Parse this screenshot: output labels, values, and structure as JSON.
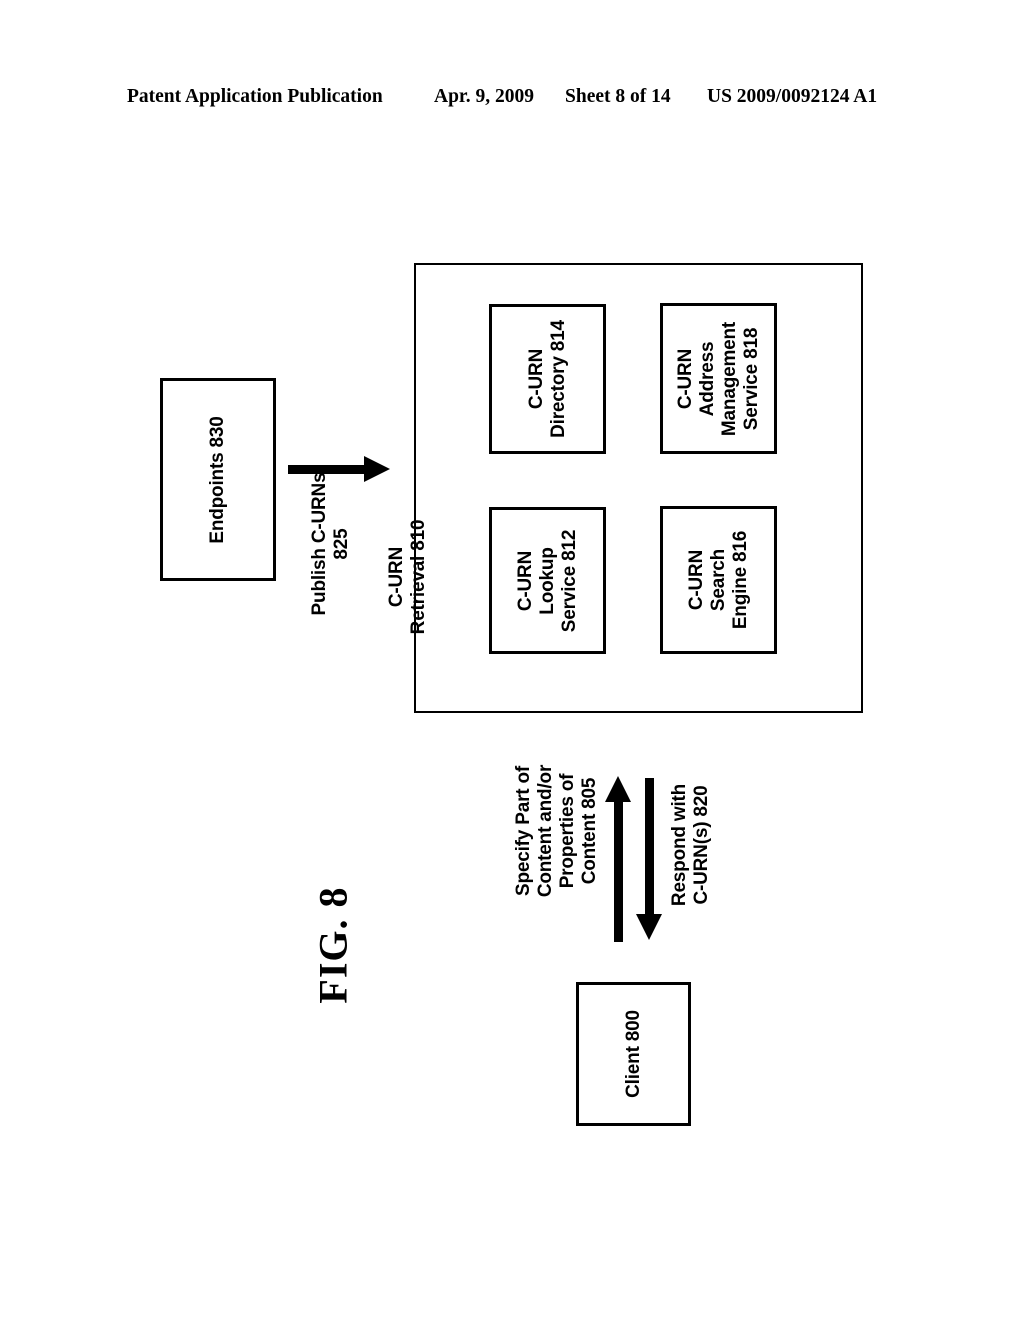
{
  "page_header": {
    "publication": "Patent Application Publication",
    "date": "Apr. 9, 2009",
    "sheet": "Sheet 8 of 14",
    "patent_number": "US 2009/0092124 A1"
  },
  "figure": {
    "caption": "FIG. 8"
  },
  "diagram": {
    "container": {
      "label": "C-URN\nRetrieval 810"
    },
    "boxes": [
      {
        "id": "directory",
        "label": "C-URN\nDirectory 814"
      },
      {
        "id": "address_management",
        "label": "C-URN\nAddress\nManagement\nService 818"
      },
      {
        "id": "lookup",
        "label": "C-URN\nLookup\nService 812"
      },
      {
        "id": "search",
        "label": "C-URN\nSearch\nEngine 816"
      },
      {
        "id": "endpoints",
        "label": "Endpoints 830"
      },
      {
        "id": "client",
        "label": "Client 800"
      }
    ],
    "arrows": [
      {
        "id": "publish",
        "label": "Publish C-URNs\n825",
        "direction": "right"
      },
      {
        "id": "specify",
        "label": "Specify Part of\nContent and/or\nProperties of\nContent 805",
        "direction": "up"
      },
      {
        "id": "respond",
        "label": "Respond with\nC-URN(s) 820",
        "direction": "down"
      }
    ]
  },
  "colors": {
    "ink": "#000000",
    "paper": "#ffffff"
  }
}
